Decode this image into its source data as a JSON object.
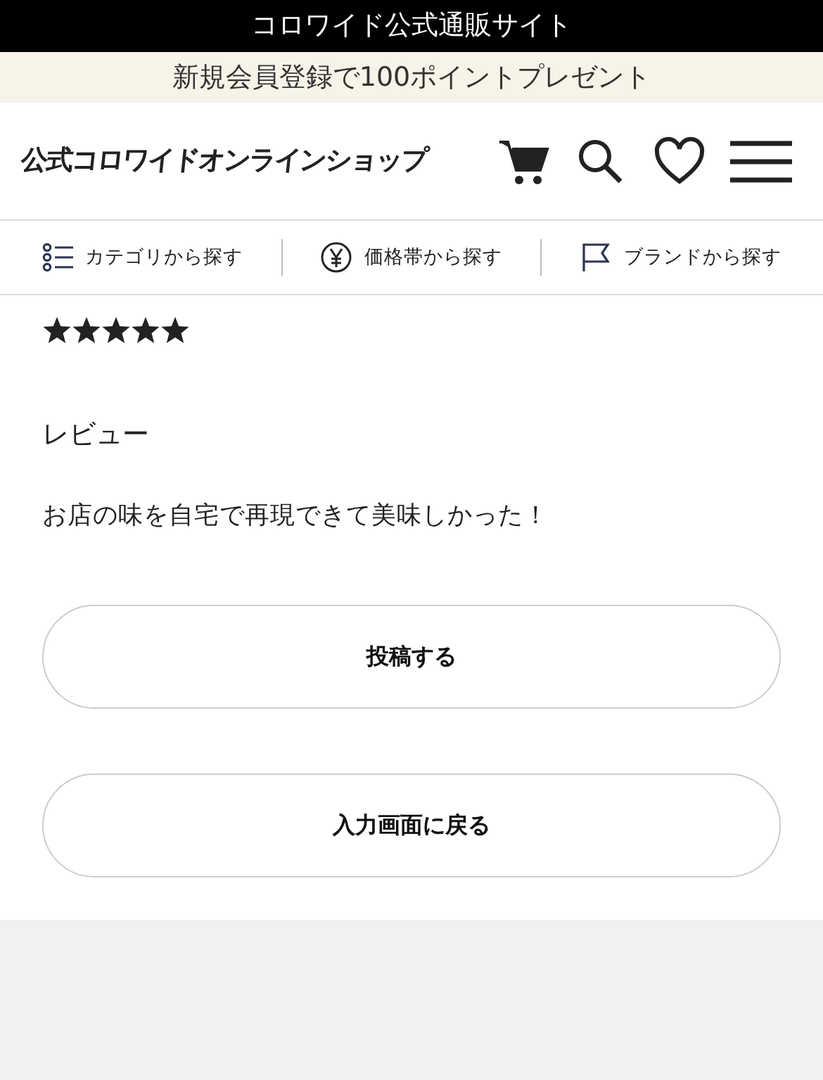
{
  "top_bar": {
    "title": "コロワイド公式通販サイト"
  },
  "promo_bar": {
    "text": "新規会員登録で100ポイントプレゼント"
  },
  "header": {
    "logo": "公式コロワイドオンラインショップ",
    "icons": [
      {
        "kind": "cart"
      },
      {
        "kind": "search"
      },
      {
        "kind": "heart"
      },
      {
        "kind": "menu"
      }
    ]
  },
  "nav": [
    {
      "kind": "list",
      "label": "カテゴリから探す"
    },
    {
      "kind": "yen",
      "label": "価格帯から探す"
    },
    {
      "kind": "flag",
      "label": "ブランドから探す"
    }
  ],
  "review": {
    "stars": 5,
    "heading": "レビュー",
    "body": "お店の味を自宅で再現できて美味しかった！"
  },
  "buttons": [
    {
      "label": "投稿する"
    },
    {
      "label": "入力画面に戻る"
    }
  ]
}
